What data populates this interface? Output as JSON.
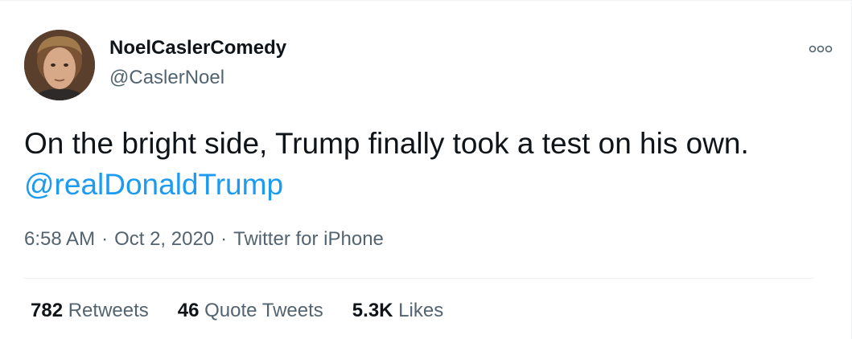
{
  "user": {
    "display_name": "NoelCaslerComedy",
    "handle": "@CaslerNoel",
    "avatar_icon": "profile-photo"
  },
  "tweet": {
    "text": "On the bright side, Trump finally took a test on his own.",
    "mention": "@realDonaldTrump"
  },
  "meta": {
    "time": "6:58 AM",
    "separator": "·",
    "date": "Oct 2, 2020",
    "source": "Twitter for iPhone"
  },
  "stats": {
    "retweets_count": "782",
    "retweets_label": "Retweets",
    "quotes_count": "46",
    "quotes_label": "Quote Tweets",
    "likes_count": "5.3K",
    "likes_label": "Likes"
  },
  "icons": {
    "more": "more-options-icon"
  },
  "colors": {
    "text_primary": "#0f1419",
    "text_secondary": "#536471",
    "link": "#1d9bf0",
    "divider": "#eff3f4"
  }
}
